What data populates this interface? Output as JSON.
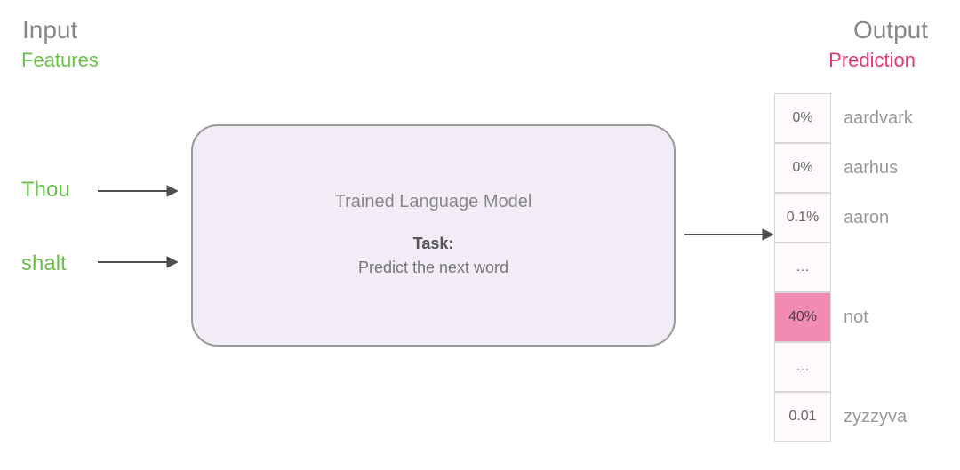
{
  "headers": {
    "input": "Input",
    "output": "Output",
    "features": "Features",
    "prediction": "Prediction"
  },
  "inputs": {
    "word1": "Thou",
    "word2": "shalt"
  },
  "model": {
    "title": "Trained Language Model",
    "task_label": "Task:",
    "task_desc": "Predict the next word"
  },
  "output": {
    "rows": [
      {
        "value": "0%",
        "label": "aardvark",
        "highlight": false
      },
      {
        "value": "0%",
        "label": "aarhus",
        "highlight": false
      },
      {
        "value": "0.1%",
        "label": "aaron",
        "highlight": false
      },
      {
        "value": "…",
        "label": "",
        "highlight": false
      },
      {
        "value": "40%",
        "label": "not",
        "highlight": true
      },
      {
        "value": "…",
        "label": "",
        "highlight": false
      },
      {
        "value": "0.01",
        "label": "zyzzyva",
        "highlight": false
      }
    ]
  }
}
